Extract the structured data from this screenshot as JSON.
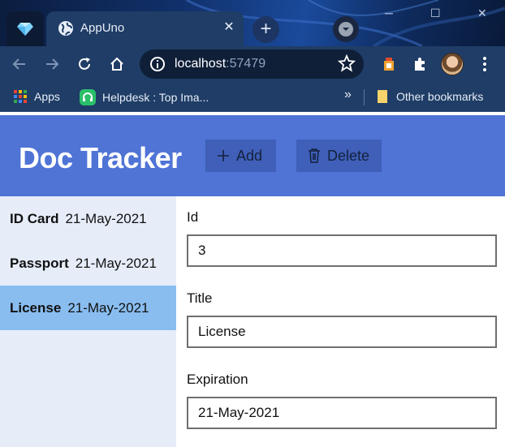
{
  "browser": {
    "tab_title": "AppUno",
    "tab_close": "✕",
    "new_tab": "+",
    "url_host": "localhost",
    "url_port": ":57479",
    "bookmarks": {
      "apps": "Apps",
      "helpdesk": "Helpdesk : Top Ima...",
      "overflow": "»",
      "other": "Other bookmarks"
    },
    "window_controls": {
      "minimize": "─",
      "maximize": "☐",
      "close": "✕"
    },
    "icons": [
      "profile-gem-icon",
      "globe-icon",
      "back-arrow-icon",
      "forward-arrow-icon",
      "reload-icon",
      "home-icon",
      "info-icon",
      "star-icon",
      "extension-icon",
      "puzzle-icon",
      "menu-dots-icon",
      "apps-grid-icon",
      "headset-icon",
      "folder-icon"
    ]
  },
  "app": {
    "title": "Doc Tracker",
    "add_label": "Add",
    "delete_label": "Delete",
    "header_color": "#4f74d6",
    "selected_row_color": "#89bdf0",
    "documents": [
      {
        "title": "ID Card",
        "date": "21-May-2021"
      },
      {
        "title": "Passport",
        "date": "21-May-2021"
      },
      {
        "title": "License",
        "date": "21-May-2021",
        "selected": true
      }
    ],
    "form": {
      "id_label": "Id",
      "id_value": "3",
      "title_label": "Title",
      "title_value": "License",
      "expiration_label": "Expiration",
      "expiration_value": "21-May-2021"
    }
  }
}
